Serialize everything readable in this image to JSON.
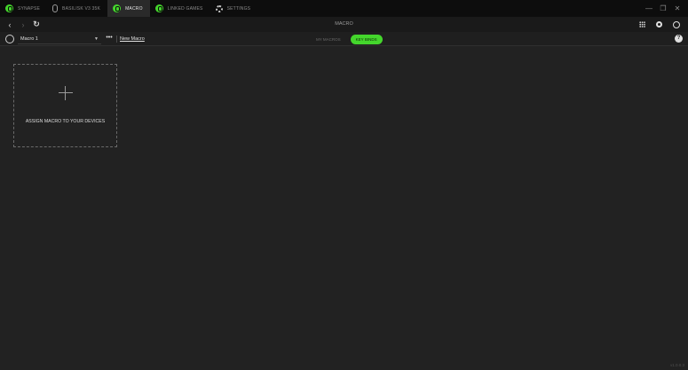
{
  "tabs": [
    {
      "label": "SYNAPSE",
      "icon": "synapse-logo-icon",
      "active": false
    },
    {
      "label": "BASILISK V3 35K",
      "icon": "mouse-icon",
      "active": false
    },
    {
      "label": "MACRO",
      "icon": "macro-icon",
      "active": true
    },
    {
      "label": "LINKED GAMES",
      "icon": "games-icon",
      "active": false
    },
    {
      "label": "SETTINGS",
      "icon": "gear-icon",
      "active": false
    }
  ],
  "window_controls": {
    "minimize": "—",
    "maximize": "❐",
    "close": "✕"
  },
  "nav": {
    "title": "MACRO",
    "back": "‹",
    "forward": "›",
    "refresh": "↻"
  },
  "toolbar": {
    "profile_selected": "Macro 1",
    "more_label": "•••",
    "new_macro_label": "New Macro",
    "segments": [
      {
        "label": "MY MACROS",
        "active": false
      },
      {
        "label": "KEY BINDS",
        "active": true
      }
    ],
    "help_label": "?"
  },
  "main": {
    "assign_label": "ASSIGN MACRO TO YOUR DEVICES"
  },
  "version": "v1.0.0.3",
  "colors": {
    "accent": "#44d62c",
    "background": "#222222",
    "tabbar": "#0d0d0d"
  }
}
